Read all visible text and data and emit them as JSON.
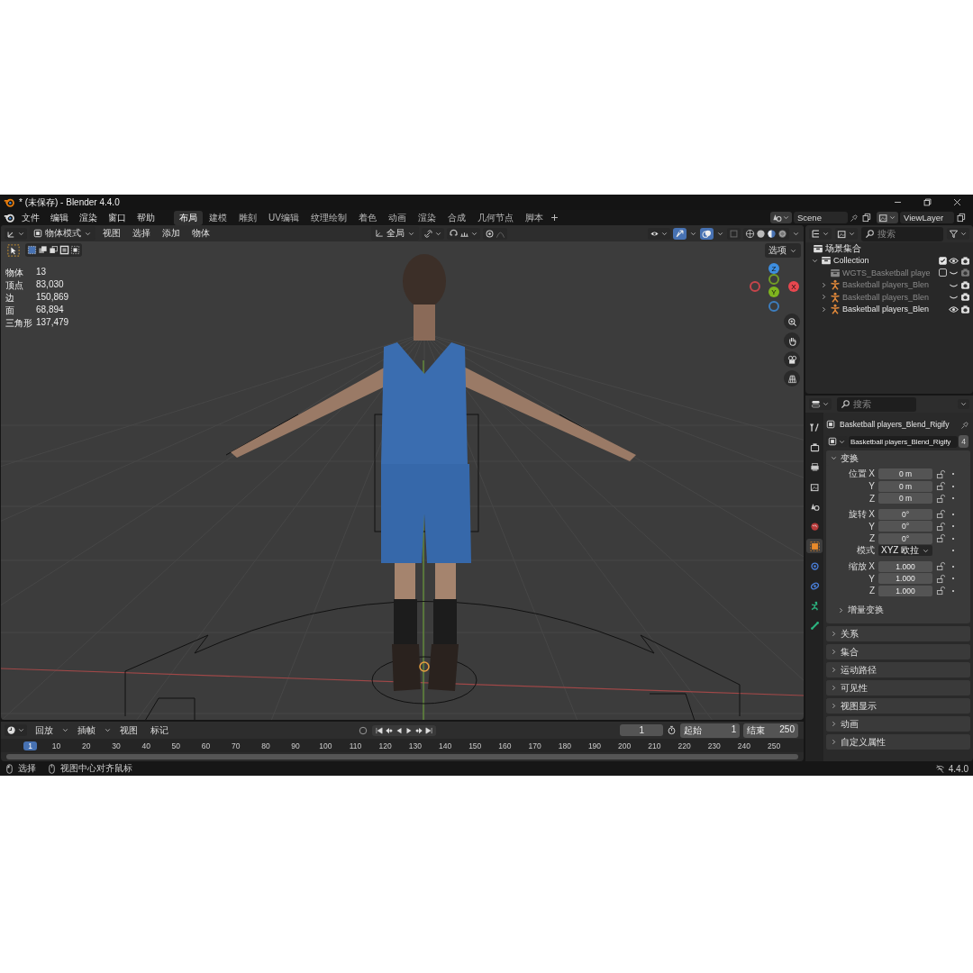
{
  "window": {
    "title": "* (未保存) - Blender 4.4.0"
  },
  "menu": [
    "文件",
    "编辑",
    "渲染",
    "窗口",
    "帮助"
  ],
  "workspaces": [
    {
      "label": "布局",
      "selected": true
    },
    {
      "label": "建模",
      "selected": false
    },
    {
      "label": "雕刻",
      "selected": false
    },
    {
      "label": "UV编辑",
      "selected": false
    },
    {
      "label": "纹理绘制",
      "selected": false
    },
    {
      "label": "着色",
      "selected": false
    },
    {
      "label": "动画",
      "selected": false
    },
    {
      "label": "渲染",
      "selected": false
    },
    {
      "label": "合成",
      "selected": false
    },
    {
      "label": "几何节点",
      "selected": false
    },
    {
      "label": "脚本",
      "selected": false
    }
  ],
  "scene": "Scene",
  "view_layer": "ViewLayer",
  "viewport": {
    "mode": "物体模式",
    "menus": [
      "视图",
      "选择",
      "添加",
      "物体"
    ],
    "orientation": "全局",
    "options": "选项",
    "stats": [
      {
        "label": "物体",
        "value": "13"
      },
      {
        "label": "顶点",
        "value": "83,030"
      },
      {
        "label": "边",
        "value": "150,869"
      },
      {
        "label": "面",
        "value": "68,894"
      },
      {
        "label": "三角形",
        "value": "137,479"
      }
    ],
    "gizmo_axes": [
      {
        "label": "Z",
        "color": "#3d8ee0"
      },
      {
        "label": "Y",
        "color": "#7fb51f"
      },
      {
        "label": "X",
        "color": "#e8474f"
      }
    ]
  },
  "timeline": {
    "menus": [
      "回放",
      "插帧",
      "视图",
      "标记"
    ],
    "current_frame": "1",
    "start_label": "起始",
    "start": "1",
    "end_label": "结束",
    "end": "250",
    "playhead": "1",
    "ticks": [
      "10",
      "20",
      "30",
      "40",
      "50",
      "60",
      "70",
      "80",
      "90",
      "100",
      "110",
      "120",
      "130",
      "140",
      "150",
      "160",
      "170",
      "180",
      "190",
      "200",
      "210",
      "220",
      "230",
      "240",
      "250"
    ]
  },
  "outliner": {
    "search_placeholder": "搜索",
    "root": "场景集合",
    "items": [
      {
        "label": "Collection",
        "kind": "collection",
        "expanded": true,
        "checked": true,
        "visible": true,
        "children": [
          {
            "label": "WGTS_Basketball playe",
            "kind": "collection",
            "checked": false,
            "visible": false
          },
          {
            "label": "Basketball players_Blen",
            "kind": "armature",
            "expanded": false,
            "visible": false
          },
          {
            "label": "Basketball players_Blen",
            "kind": "armature",
            "expanded": false,
            "visible": false
          },
          {
            "label": "Basketball players_Blen",
            "kind": "armature",
            "expanded": false,
            "visible": true
          }
        ]
      }
    ]
  },
  "properties": {
    "search_placeholder": "搜索",
    "object_name": "Basketball players_Blend_Rigify",
    "data_name": "Basketball players_Blend_Rigify",
    "users": "4",
    "tabs": [
      {
        "kind": "tool",
        "selected": false
      },
      {
        "kind": "render",
        "selected": false
      },
      {
        "kind": "output",
        "selected": false
      },
      {
        "kind": "view_layer",
        "selected": false
      },
      {
        "kind": "scene",
        "selected": false
      },
      {
        "kind": "world",
        "selected": false
      },
      {
        "kind": "object",
        "selected": true
      },
      {
        "kind": "physics",
        "selected": false
      },
      {
        "kind": "constraints",
        "selected": false
      },
      {
        "kind": "armature",
        "selected": false
      },
      {
        "kind": "bone",
        "selected": false
      }
    ],
    "transform": {
      "title": "变换",
      "expanded": true,
      "groups": [
        {
          "rows": [
            {
              "label": "位置 X",
              "value": "0 m",
              "kind": "number"
            },
            {
              "label": "Y",
              "value": "0 m",
              "kind": "number"
            },
            {
              "label": "Z",
              "value": "0 m",
              "kind": "number"
            }
          ]
        },
        {
          "rows": [
            {
              "label": "旋转 X",
              "value": "0°",
              "kind": "number"
            },
            {
              "label": "Y",
              "value": "0°",
              "kind": "number"
            },
            {
              "label": "Z",
              "value": "0°",
              "kind": "number"
            },
            {
              "label": "模式",
              "value": "XYZ 欧拉",
              "kind": "dropdown"
            }
          ]
        },
        {
          "rows": [
            {
              "label": "缩放 X",
              "value": "1.000",
              "kind": "number"
            },
            {
              "label": "Y",
              "value": "1.000",
              "kind": "number"
            },
            {
              "label": "Z",
              "value": "1.000",
              "kind": "number"
            }
          ]
        }
      ],
      "subpanel": {
        "title": "增量变换",
        "expanded": false
      }
    },
    "panels": [
      {
        "title": "关系",
        "expanded": false
      },
      {
        "title": "集合",
        "expanded": false
      },
      {
        "title": "运动路径",
        "expanded": false
      },
      {
        "title": "可见性",
        "expanded": false
      },
      {
        "title": "视图显示",
        "expanded": false
      },
      {
        "title": "动画",
        "expanded": false
      },
      {
        "title": "自定义属性",
        "expanded": false
      }
    ]
  },
  "status_bar": {
    "hints": [
      "选择",
      "视图中心对齐鼠标"
    ],
    "version": "4.4.0"
  }
}
